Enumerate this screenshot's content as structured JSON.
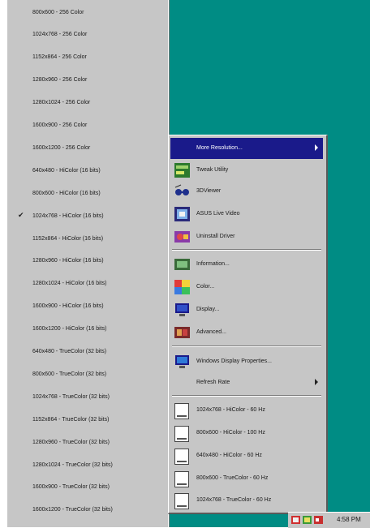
{
  "resolution_menu": {
    "items": [
      {
        "label": "800x600 - 256 Color",
        "checked": false
      },
      {
        "label": "1024x768 - 256 Color",
        "checked": false
      },
      {
        "label": "1152x864 - 256 Color",
        "checked": false
      },
      {
        "label": "1280x960 - 256 Color",
        "checked": false
      },
      {
        "label": "1280x1024 - 256 Color",
        "checked": false
      },
      {
        "label": "1600x900 - 256 Color",
        "checked": false
      },
      {
        "label": "1600x1200 - 256 Color",
        "checked": false
      },
      {
        "label": "640x480 - HiColor (16 bits)",
        "checked": false
      },
      {
        "label": "800x600 - HiColor (16 bits)",
        "checked": false
      },
      {
        "label": "1024x768 - HiColor (16 bits)",
        "checked": true
      },
      {
        "label": "1152x864 - HiColor (16 bits)",
        "checked": false
      },
      {
        "label": "1280x960 - HiColor (16 bits)",
        "checked": false
      },
      {
        "label": "1280x1024 - HiColor (16 bits)",
        "checked": false
      },
      {
        "label": "1600x900 - HiColor (16 bits)",
        "checked": false
      },
      {
        "label": "1600x1200 - HiColor (16 bits)",
        "checked": false
      },
      {
        "label": "640x480 - TrueColor (32 bits)",
        "checked": false
      },
      {
        "label": "800x600 - TrueColor (32 bits)",
        "checked": false
      },
      {
        "label": "1024x768 - TrueColor (32 bits)",
        "checked": false
      },
      {
        "label": "1152x864 - TrueColor (32 bits)",
        "checked": false
      },
      {
        "label": "1280x960 - TrueColor (32 bits)",
        "checked": false
      },
      {
        "label": "1280x1024 - TrueColor (32 bits)",
        "checked": false
      },
      {
        "label": "1600x900 - TrueColor (32 bits)",
        "checked": false
      },
      {
        "label": "1600x1200 - TrueColor (32 bits)",
        "checked": false
      }
    ],
    "check_glyph": "✔"
  },
  "context_menu": {
    "more_resolution": "More Resolution...",
    "tweak_utility": "Tweak Utility",
    "viewer": "3DViewer",
    "live_video": "ASUS Live Video",
    "uninstall": "Uninstall Driver",
    "information": "Information...",
    "color": "Color...",
    "display": "Display...",
    "advanced": "Advanced...",
    "windows_display_properties": "Windows Display Properties...",
    "refresh_rate": "Refresh Rate",
    "quick_modes": [
      "1024x768 - HiColor - 60 Hz",
      "800x600 - HiColor - 100 Hz",
      "640x480 - HiColor - 60 Hz",
      "800x600 - TrueColor - 60 Hz",
      "1024x768 - TrueColor - 60 Hz"
    ]
  },
  "taskbar": {
    "clock": "4:58 PM"
  },
  "colors": {
    "desktop": "#008c84",
    "menu": "#c6c6c6",
    "selection": "#1a1a8a"
  }
}
